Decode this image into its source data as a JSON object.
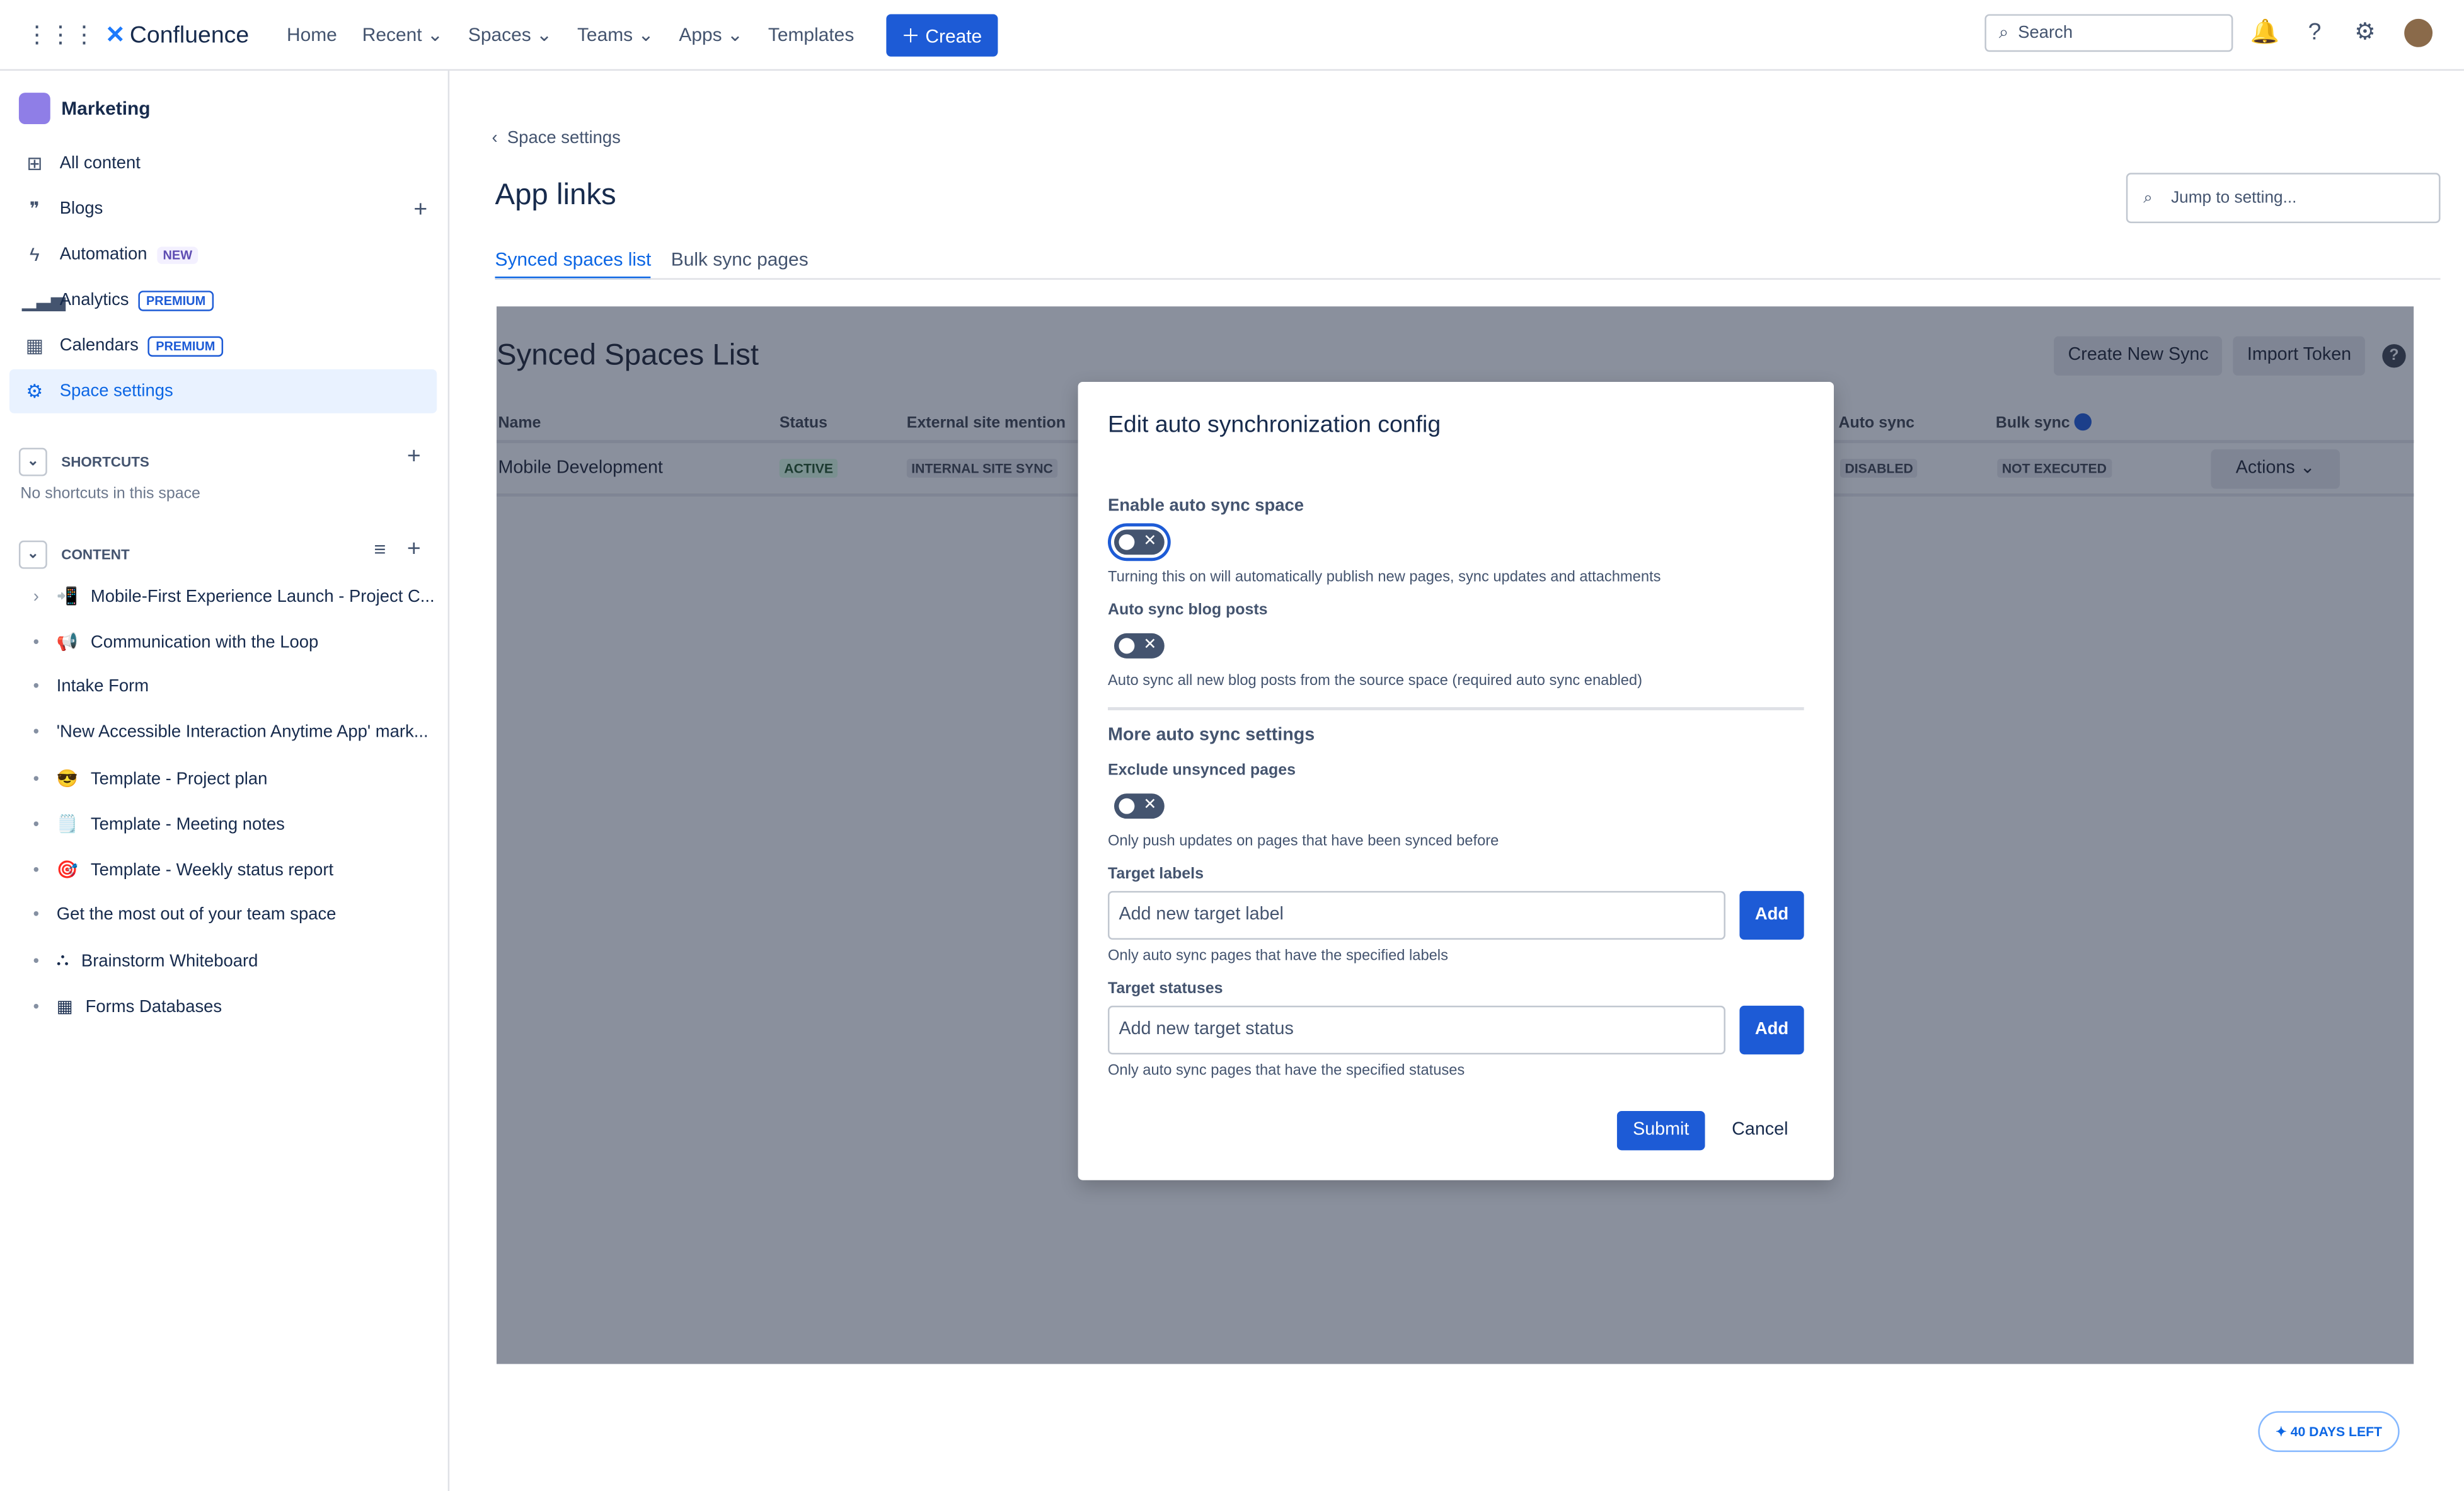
{
  "topbar": {
    "app_name": "Confluence",
    "nav": [
      "Home",
      "Recent",
      "Spaces",
      "Teams",
      "Apps",
      "Templates"
    ],
    "create_label": "Create",
    "search_placeholder": "Search"
  },
  "sidebar": {
    "space_name": "Marketing",
    "items": [
      {
        "label": "All content",
        "icon": "grid-icon"
      },
      {
        "label": "Blogs",
        "icon": "quote-icon"
      },
      {
        "label": "Automation",
        "icon": "lightning-icon",
        "badge": "NEW"
      },
      {
        "label": "Analytics",
        "icon": "bar-chart-icon",
        "badge": "PREMIUM"
      },
      {
        "label": "Calendars",
        "icon": "calendar-icon",
        "badge": "PREMIUM"
      },
      {
        "label": "Space settings",
        "icon": "gear-icon"
      }
    ],
    "shortcuts_title": "SHORTCUTS",
    "shortcuts_empty": "No shortcuts in this space",
    "content_title": "CONTENT",
    "content": [
      {
        "label": "Mobile-First Experience Launch - Project C...",
        "emoji": "📲"
      },
      {
        "label": "Communication with the Loop",
        "emoji": "📢"
      },
      {
        "label": "Intake Form",
        "emoji": ""
      },
      {
        "label": "'New Accessible Interaction Anytime App' mark...",
        "emoji": ""
      },
      {
        "label": "Template - Project plan",
        "emoji": "😎"
      },
      {
        "label": "Template - Meeting notes",
        "emoji": "🗒️"
      },
      {
        "label": "Template - Weekly status report",
        "emoji": "🎯"
      },
      {
        "label": "Get the most out of your team space",
        "emoji": ""
      },
      {
        "label": "Brainstorm Whiteboard",
        "emoji": "⛬"
      },
      {
        "label": "Forms Databases",
        "emoji": "▦"
      }
    ]
  },
  "main": {
    "breadcrumb": "Space settings",
    "title": "App links",
    "jump_placeholder": "Jump to setting...",
    "tabs": [
      {
        "label": "Synced spaces list",
        "active": true
      },
      {
        "label": "Bulk sync pages",
        "active": false
      }
    ],
    "list_title": "Synced Spaces List",
    "create_sync": "Create New Sync",
    "import_token": "Import Token",
    "columns": [
      "Name",
      "Status",
      "External site mention",
      "Auto sync",
      "Bulk sync"
    ],
    "row": {
      "name": "Mobile Development",
      "status": "ACTIVE",
      "external": "INTERNAL SITE SYNC",
      "auto_sync": "DISABLED",
      "bulk_sync": "NOT EXECUTED",
      "actions": "Actions"
    }
  },
  "modal": {
    "title": "Edit auto synchronization config",
    "enable_label": "Enable auto sync space",
    "enable_help": "Turning this on will automatically publish new pages, sync updates and attachments",
    "enable_on": false,
    "blog_label": "Auto sync blog posts",
    "blog_help": "Auto sync all new blog posts from the source space (required auto sync enabled)",
    "blog_on": false,
    "more_title": "More auto sync settings",
    "exclude_label": "Exclude unsynced pages",
    "exclude_help": "Only push updates on pages that have been synced before",
    "exclude_on": false,
    "labels_label": "Target labels",
    "labels_placeholder": "Add new target label",
    "labels_help": "Only auto sync pages that have the specified labels",
    "statuses_label": "Target statuses",
    "statuses_placeholder": "Add new target status",
    "statuses_help": "Only auto sync pages that have the specified statuses",
    "add": "Add",
    "submit": "Submit",
    "cancel": "Cancel"
  },
  "trial": "40 DAYS LEFT",
  "colors": {
    "accent": "#1d5bd6",
    "overlay": "#8a909d"
  }
}
